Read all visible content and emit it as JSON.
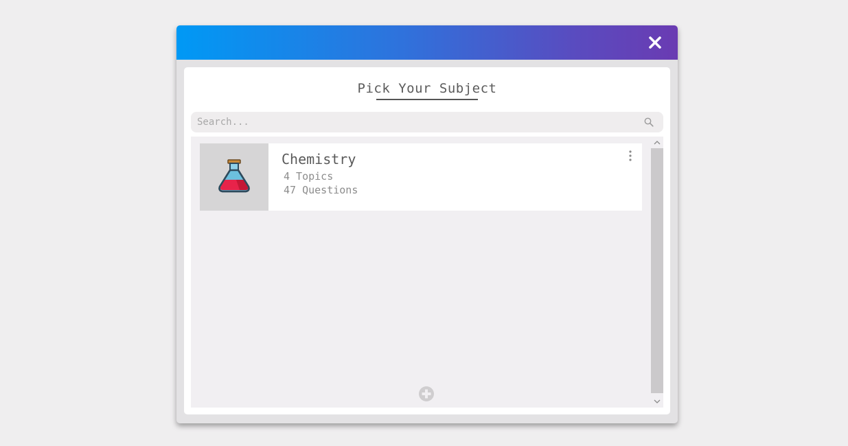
{
  "dialog": {
    "title": "Pick Your Subject",
    "close_icon": "close-icon",
    "header_gradient": [
      "#0099f5",
      "#6a3bb2"
    ]
  },
  "search": {
    "placeholder": "Search...",
    "value": "",
    "icon": "search-icon"
  },
  "subjects": [
    {
      "name": "Chemistry",
      "topics": "4 Topics",
      "questions": "47 Questions",
      "icon": "flask-icon",
      "menu_icon": "more-vertical-icon"
    }
  ],
  "list": {
    "add_icon": "add-circle-icon"
  },
  "colors": {
    "background": "#efeeef",
    "panel": "#ffffff",
    "list_background": "#f1eff2",
    "flask_liquid": "#e8234a",
    "flask_glass": "#5fa8c9"
  }
}
